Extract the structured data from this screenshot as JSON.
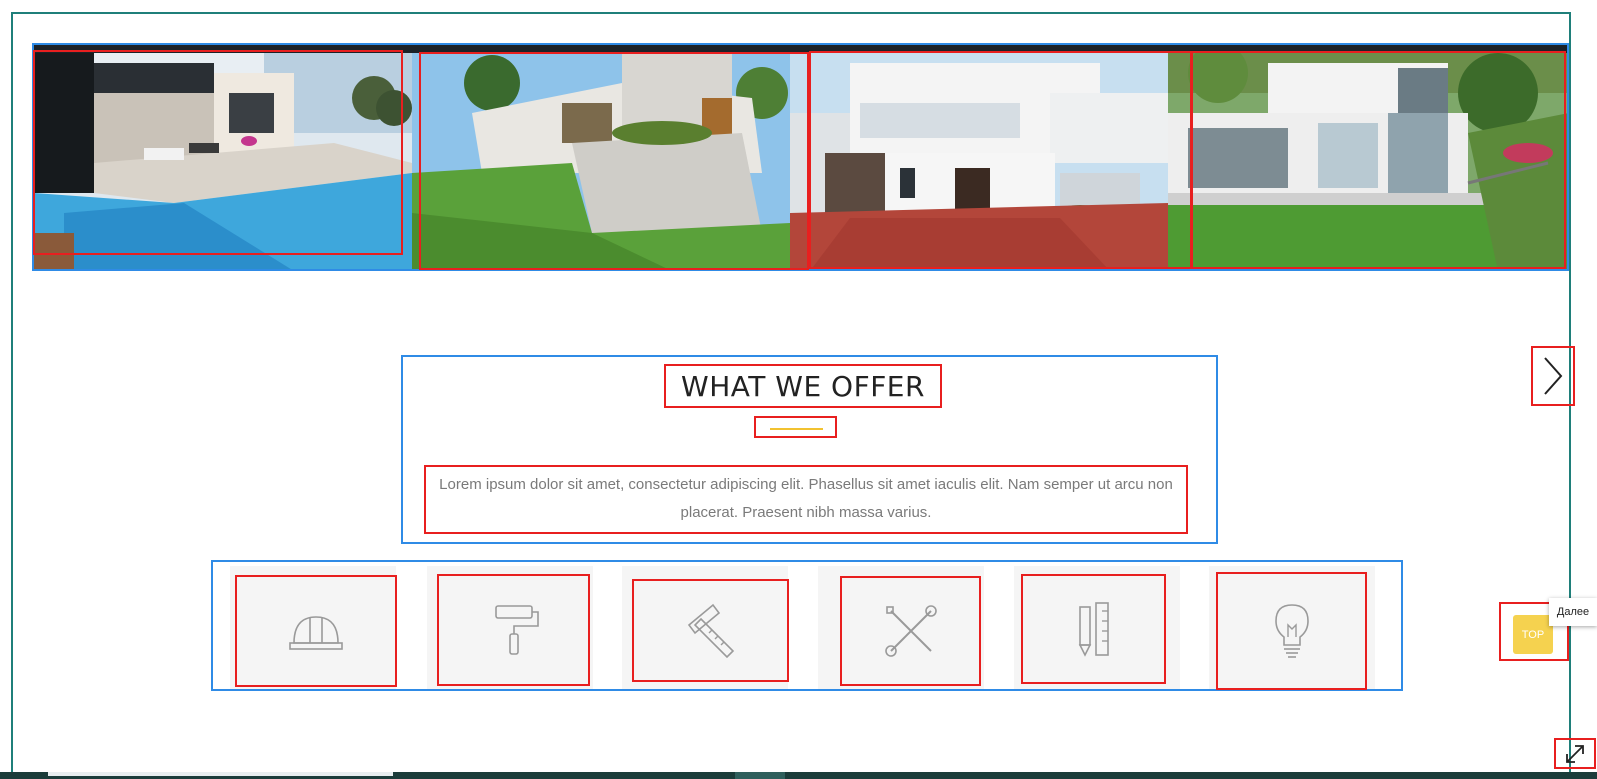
{
  "section": {
    "title": "WHAT WE OFFER",
    "description": "Lorem ipsum dolor sit amet, consectetur adipiscing elit. Phasellus sit amet iaculis elit. Nam semper ut arcu non placerat. Praesent nibh massa varius."
  },
  "gallery": {
    "photos": [
      {
        "subject": "modern house with infinity pool"
      },
      {
        "subject": "concrete villa with lawn"
      },
      {
        "subject": "white two-storey house with brick driveway"
      },
      {
        "subject": "white villa with glass facade and garden"
      }
    ]
  },
  "services": [
    {
      "icon": "hard-hat-icon"
    },
    {
      "icon": "paint-roller-icon"
    },
    {
      "icon": "square-ruler-icon"
    },
    {
      "icon": "wrench-screwdriver-icon"
    },
    {
      "icon": "pencil-ruler-icon"
    },
    {
      "icon": "lightbulb-icon"
    }
  ],
  "controls": {
    "top_label": "TOP",
    "tooltip": "Далее"
  },
  "colors": {
    "frame": "#1f7f7a",
    "accent_underline": "#f2c230",
    "top_button": "#f5d24f",
    "outline_red": "#e81f1f",
    "outline_blue": "#2f8be6"
  }
}
